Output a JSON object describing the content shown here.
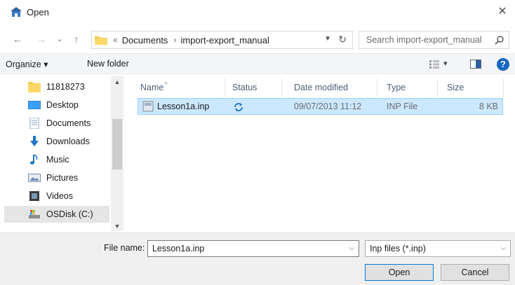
{
  "window": {
    "title": "Open",
    "close_glyph": "✕"
  },
  "nav": {
    "back_glyph": "←",
    "forward_glyph": "→",
    "recent_glyph": "⌄",
    "up_glyph": "↑",
    "address": {
      "overflow": "«",
      "crumbs": [
        "Documents",
        "import-export_manual"
      ],
      "separator": "›"
    },
    "search": {
      "placeholder": "Search import-export_manual"
    }
  },
  "toolbar": {
    "organize_label": "Organize ▾",
    "new_folder_label": "New folder",
    "help_glyph": "?"
  },
  "sidebar": {
    "items": [
      {
        "label": "11818273",
        "icon": "folder-icon"
      },
      {
        "label": "Desktop",
        "icon": "desktop-icon"
      },
      {
        "label": "Documents",
        "icon": "documents-icon"
      },
      {
        "label": "Downloads",
        "icon": "downloads-icon"
      },
      {
        "label": "Music",
        "icon": "music-icon"
      },
      {
        "label": "Pictures",
        "icon": "pictures-icon"
      },
      {
        "label": "Videos",
        "icon": "videos-icon"
      },
      {
        "label": "OSDisk (C:)",
        "icon": "drive-icon",
        "selected": true
      }
    ]
  },
  "files": {
    "columns": [
      "Name",
      "Status",
      "Date modified",
      "Type",
      "Size"
    ],
    "rows": [
      {
        "name": "Lesson1a.inp",
        "status_icon": "sync-icon",
        "date": "09/07/2013 11:12",
        "type": "INP File",
        "size": "8 KB",
        "selected": true
      }
    ]
  },
  "footer": {
    "file_name_label": "File name:",
    "file_name_value": "Lesson1a.inp",
    "file_type_value": "Inp files (*.inp)",
    "open_label": "Open",
    "cancel_label": "Cancel"
  },
  "colors": {
    "selection_bg": "#cce8ff",
    "selection_border": "#99d1ff",
    "accent": "#0078d7",
    "help_blue": "#1666c0"
  }
}
